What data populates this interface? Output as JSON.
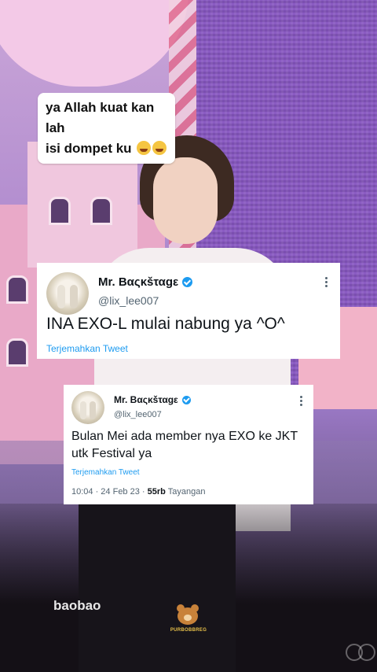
{
  "caption": {
    "line1": "ya Allah kuat kan lah",
    "line2": "isi dompet ku",
    "emoji_icon": "loudly-crying-face-icon"
  },
  "tweets": [
    {
      "name": "Mr. Bαςκšταgε",
      "handle": "@lix_lee007",
      "text": "INA EXO-L mulai nabung ya ^O^",
      "translate_label": "Terjemahkan Tweet",
      "verified_icon": "verified-badge-icon",
      "more_icon": "more-vertical-icon"
    },
    {
      "name": "Mr. Bαςκšταgε",
      "handle": "@lix_lee007",
      "text": "Bulan Mei ada member nya EXO ke JKT utk Festival ya",
      "translate_label": "Terjemahkan Tweet",
      "time": "10:04 · 24 Feb 23 ·",
      "views_count": "55rb",
      "views_label": "Tayangan",
      "verified_icon": "verified-badge-icon",
      "more_icon": "more-vertical-icon"
    }
  ],
  "watermark": {
    "text": "baobao",
    "logo_icon": "bear-logo-icon",
    "logo_text": "PURBOBBREG"
  },
  "colors": {
    "link_blue": "#1d9bf0",
    "caption_bg": "#ffffff",
    "stage_purple": "#8a5bc2"
  }
}
